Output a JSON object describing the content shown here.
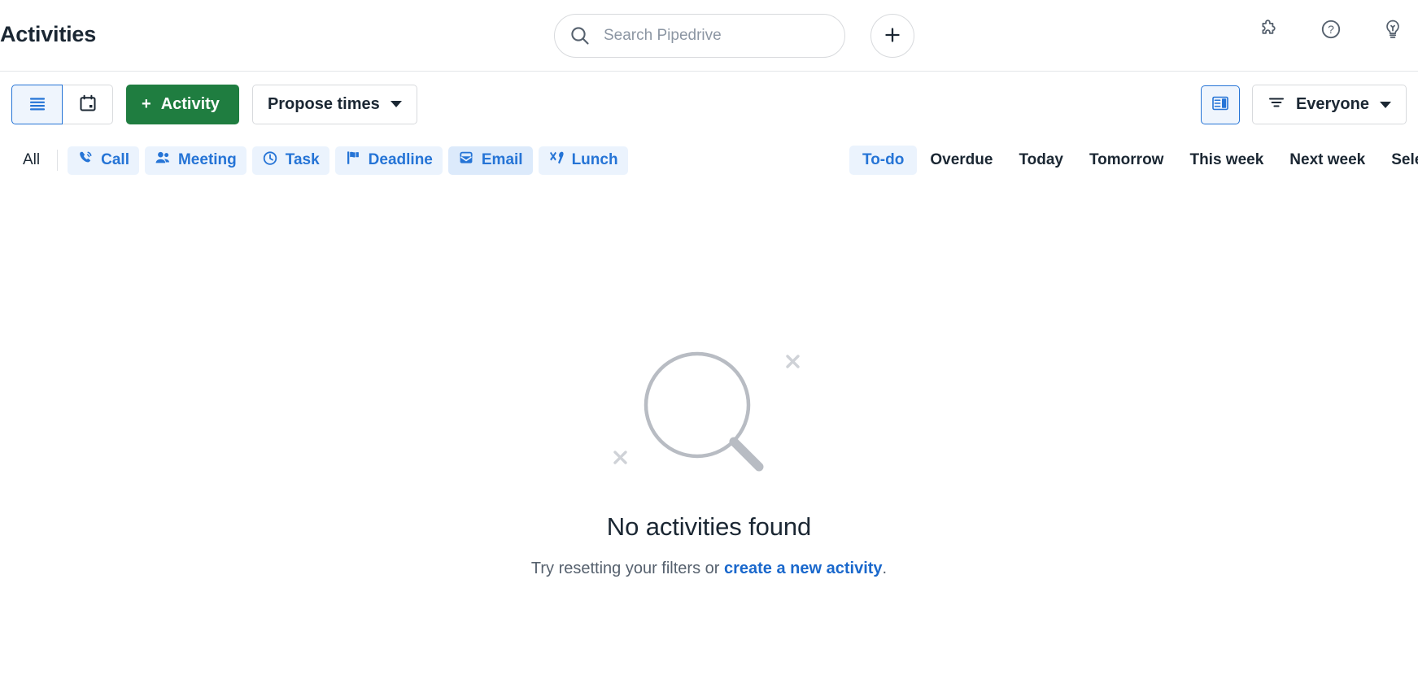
{
  "header": {
    "title": "Activities",
    "search": {
      "placeholder": "Search Pipedrive",
      "value": "",
      "icon": "search-icon"
    },
    "add_button": {
      "label": "+",
      "icon": "plus-icon"
    },
    "right_icons": [
      {
        "name": "puzzle-icon",
        "label": "Marketplace apps"
      },
      {
        "name": "help-icon",
        "label": "Help"
      },
      {
        "name": "lightbulb-icon",
        "label": "Tips"
      }
    ]
  },
  "toolbar": {
    "view_toggle": [
      {
        "name": "list-view",
        "icon": "list-icon",
        "active": true
      },
      {
        "name": "calendar-view",
        "icon": "calendar-icon",
        "active": false
      }
    ],
    "add_activity_label": "Activity",
    "add_activity_prefix": "+",
    "propose_times_label": "Propose times",
    "panel_toggle": {
      "name": "details-panel-toggle",
      "icon": "panel-icon",
      "active": true
    },
    "user_filter_label": "Everyone",
    "user_filter_icon": "filter-icon"
  },
  "filters": {
    "all_label": "All",
    "types": [
      {
        "label": "Call",
        "icon": "phone-icon",
        "hovered": false
      },
      {
        "label": "Meeting",
        "icon": "people-icon",
        "hovered": false
      },
      {
        "label": "Task",
        "icon": "clock-icon",
        "hovered": false
      },
      {
        "label": "Deadline",
        "icon": "flag-icon",
        "hovered": false
      },
      {
        "label": "Email",
        "icon": "envelope-icon",
        "hovered": true
      },
      {
        "label": "Lunch",
        "icon": "cutlery-icon",
        "hovered": false
      }
    ],
    "periods": [
      {
        "label": "To-do",
        "active": true
      },
      {
        "label": "Overdue",
        "active": false
      },
      {
        "label": "Today",
        "active": false
      },
      {
        "label": "Tomorrow",
        "active": false
      },
      {
        "label": "This week",
        "active": false
      },
      {
        "label": "Next week",
        "active": false
      },
      {
        "label": "Select p",
        "active": false
      }
    ]
  },
  "empty_state": {
    "illustration": "magnifying-glass-icon",
    "title": "No activities found",
    "subtitle_prefix": "Try resetting your filters or ",
    "link_text": "create a new activity",
    "subtitle_suffix": "."
  },
  "colors": {
    "accent_blue": "#2574d6",
    "link_blue": "#1a68cc",
    "green": "#1f7d40",
    "chip_bg": "#ebf3fd",
    "text_dark": "#1b2733",
    "text_muted": "#56616e",
    "illustration_gray": "#b8bcc3"
  }
}
